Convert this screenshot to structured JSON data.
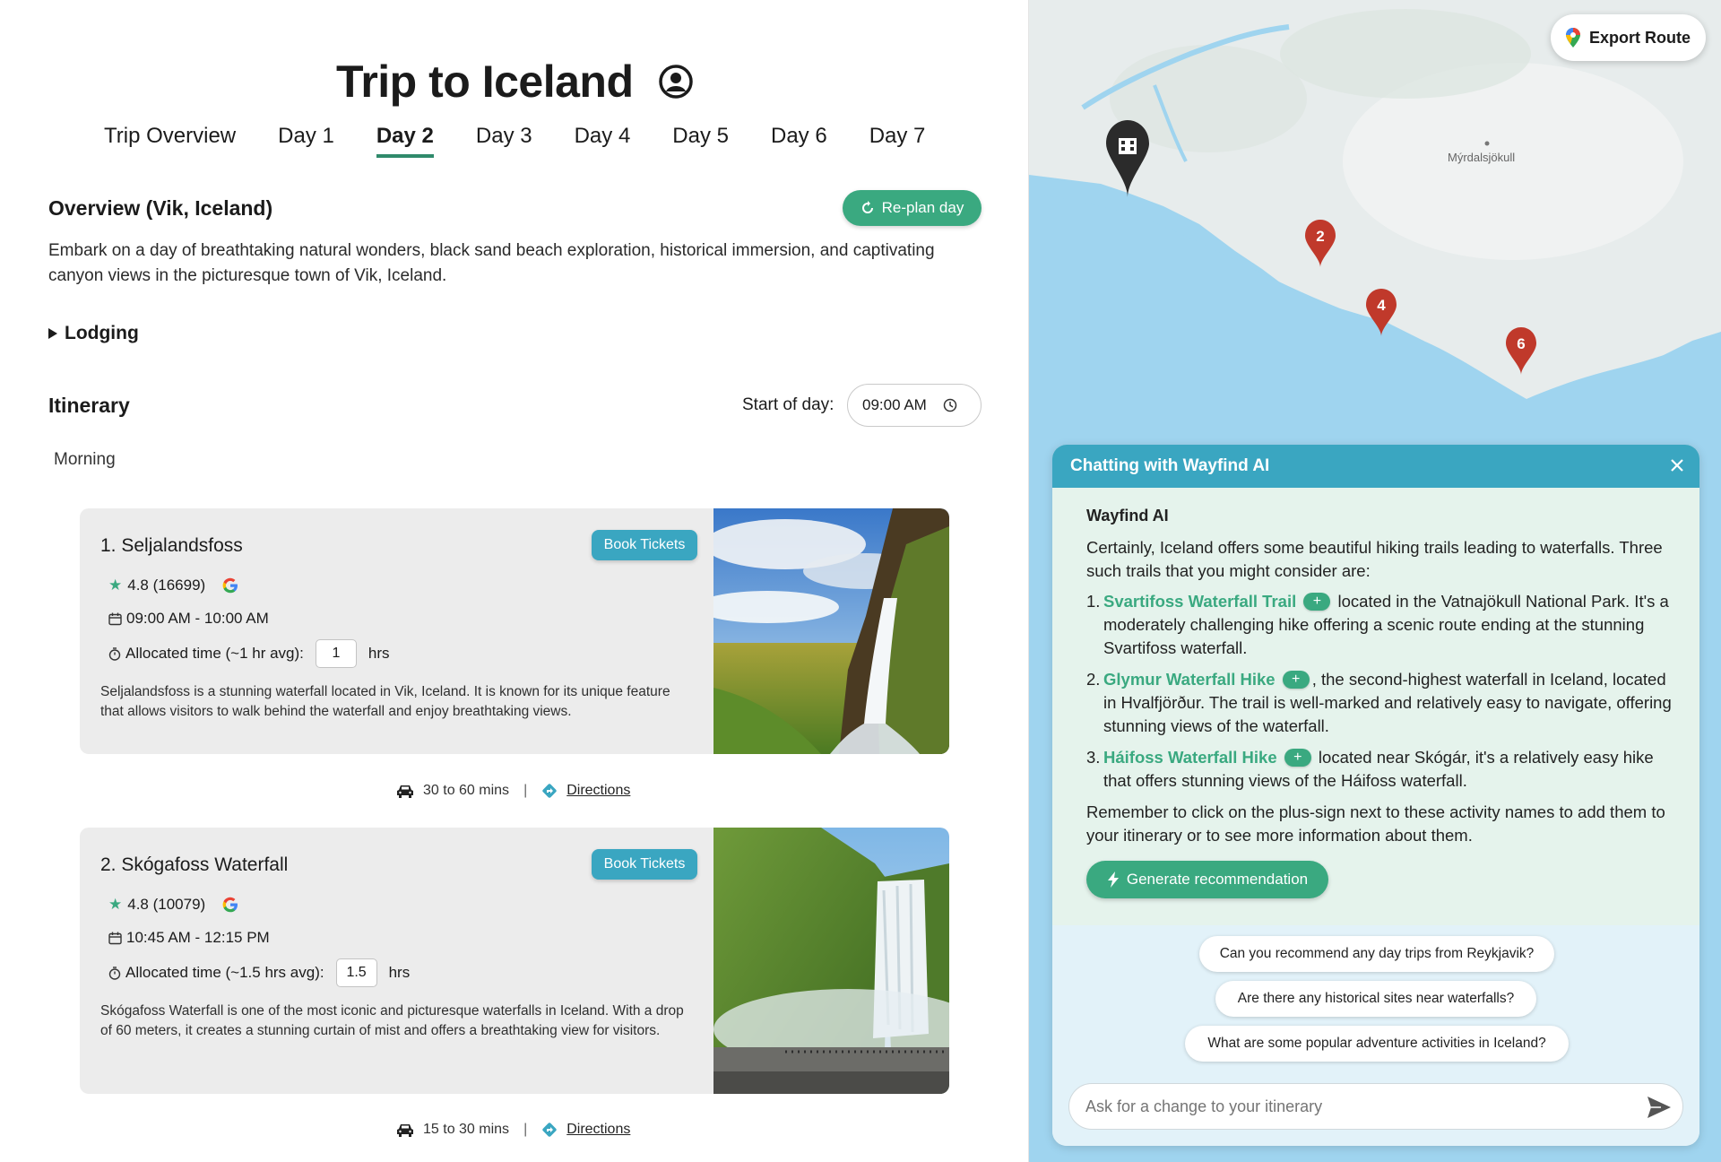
{
  "trip": {
    "title": "Trip to Iceland",
    "tabs": [
      "Trip Overview",
      "Day 1",
      "Day 2",
      "Day 3",
      "Day 4",
      "Day 5",
      "Day 6",
      "Day 7"
    ],
    "active_tab": "Day 2"
  },
  "overview": {
    "heading": "Overview (Vik, Iceland)",
    "replan_label": "Re-plan day",
    "text": "Embark on a day of breathtaking natural wonders, black sand beach exploration, historical immersion, and captivating canyon views in the picturesque town of Vik, Iceland."
  },
  "lodging": {
    "label": "Lodging"
  },
  "itinerary": {
    "heading": "Itinerary",
    "start_label": "Start of day:",
    "start_value": "09:00 AM",
    "period": "Morning",
    "items": [
      {
        "name": "1. Seljalandsfoss",
        "book_label": "Book Tickets",
        "rating": "4.8 (16699)",
        "google": "G",
        "time": "09:00 AM - 10:00 AM",
        "alloc_label": "Allocated time (~1 hr avg):",
        "alloc_value": "1",
        "alloc_unit": "hrs",
        "description": "Seljalandsfoss is a stunning waterfall located in Vik, Iceland. It is known for its unique feature that allows visitors to walk behind the waterfall and enjoy breathtaking views.",
        "travel": "30 to 60 mins",
        "directions": "Directions"
      },
      {
        "name": "2. Skógafoss Waterfall",
        "book_label": "Book Tickets",
        "rating": "4.8 (10079)",
        "google": "G",
        "time": "10:45 AM - 12:15 PM",
        "alloc_label": "Allocated time (~1.5 hrs avg):",
        "alloc_value": "1.5",
        "alloc_unit": "hrs",
        "description": "Skógafoss Waterfall is one of the most iconic and picturesque waterfalls in Iceland. With a drop of 60 meters, it creates a stunning curtain of mist and offers a breathtaking view for visitors.",
        "travel": "15 to 30 mins",
        "directions": "Directions"
      }
    ]
  },
  "map": {
    "export_label": "Export Route",
    "place_label": "Mýrdalsjökull",
    "markers": [
      "2",
      "4",
      "6"
    ]
  },
  "chat": {
    "title": "Chatting with Wayfind AI",
    "sender": "Wayfind AI",
    "intro": "Certainly, Iceland offers some beautiful hiking trails leading to waterfalls. Three such trails that you might consider are:",
    "items": [
      {
        "num": "1.",
        "name": "Svartifoss Waterfall Trail",
        "text": " located in the Vatnajökull National Park. It's a moderately challenging hike offering a scenic route ending at the stunning Svartifoss waterfall."
      },
      {
        "num": "2.",
        "name": "Glymur Waterfall Hike",
        "text": ", the second-highest waterfall in Iceland, located in Hvalfjörður. The trail is well-marked and relatively easy to navigate, offering stunning views of the waterfall."
      },
      {
        "num": "3.",
        "name": "Háifoss Waterfall Hike",
        "text": " located near Skógár, it's a relatively easy hike that offers stunning views of the Háifoss waterfall."
      }
    ],
    "outro": "Remember to click on the plus-sign next to these activity names to add them to your itinerary or to see more information about them.",
    "generate_label": "Generate recommendation",
    "suggestions": [
      "Can you recommend any day trips from Reykjavik?",
      "Are there any historical sites near waterfalls?",
      "What are some popular adventure activities in Iceland?"
    ],
    "input_placeholder": "Ask for a change to your itinerary"
  },
  "colors": {
    "accent_green": "#3aa980",
    "accent_blue": "#3aa6c1",
    "marker_red": "#c0392b",
    "water": "#9fd4ef"
  }
}
